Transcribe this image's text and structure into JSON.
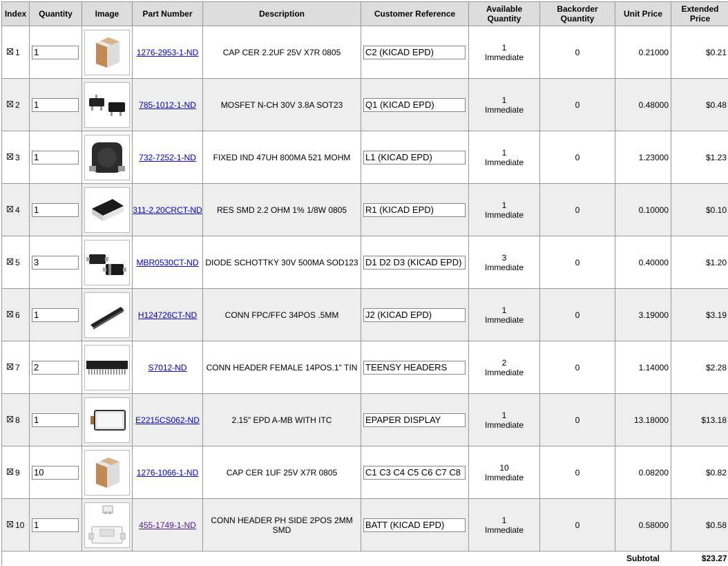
{
  "headers": {
    "index": "Index",
    "quantity": "Quantity",
    "image": "Image",
    "part_number": "Part Number",
    "description": "Description",
    "customer_reference": "Customer Reference",
    "available_quantity": "Available Quantity",
    "backorder_quantity": "Backorder Quantity",
    "unit_price": "Unit Price",
    "extended_price": "Extended Price"
  },
  "rows": [
    {
      "index": "1",
      "quantity": "1",
      "image_icon": "ceramic-capacitor-image",
      "part_number": "1276-2953-1-ND",
      "description": "CAP CER 2.2UF 25V X7R 0805",
      "customer_reference": "C2 (KICAD EPD)",
      "available_qty": "1",
      "available_status": "Immediate",
      "backorder": "0",
      "unit_price": "0.21000",
      "extended_price": "$0.21"
    },
    {
      "index": "2",
      "quantity": "1",
      "image_icon": "mosfet-image",
      "part_number": "785-1012-1-ND",
      "description": "MOSFET N-CH 30V 3.8A SOT23",
      "customer_reference": "Q1 (KICAD EPD)",
      "available_qty": "1",
      "available_status": "Immediate",
      "backorder": "0",
      "unit_price": "0.48000",
      "extended_price": "$0.48"
    },
    {
      "index": "3",
      "quantity": "1",
      "image_icon": "inductor-image",
      "part_number": "732-7252-1-ND",
      "description": "FIXED IND 47UH 800MA 521 MOHM",
      "customer_reference": "L1 (KICAD EPD)",
      "available_qty": "1",
      "available_status": "Immediate",
      "backorder": "0",
      "unit_price": "1.23000",
      "extended_price": "$1.23"
    },
    {
      "index": "4",
      "quantity": "1",
      "image_icon": "resistor-image",
      "part_number": "311-2.20CRCT-ND",
      "description": "RES SMD 2.2 OHM 1% 1/8W 0805",
      "customer_reference": "R1 (KICAD EPD)",
      "available_qty": "1",
      "available_status": "Immediate",
      "backorder": "0",
      "unit_price": "0.10000",
      "extended_price": "$0.10"
    },
    {
      "index": "5",
      "quantity": "3",
      "image_icon": "diode-image",
      "part_number": "MBR0530CT-ND",
      "description": "DIODE SCHOTTKY 30V 500MA SOD123",
      "customer_reference": "D1 D2 D3 (KICAD EPD)",
      "available_qty": "3",
      "available_status": "Immediate",
      "backorder": "0",
      "unit_price": "0.40000",
      "extended_price": "$1.20"
    },
    {
      "index": "6",
      "quantity": "1",
      "image_icon": "fpc-connector-image",
      "part_number": "H124726CT-ND",
      "description": "CONN FPC/FFC 34POS .5MM",
      "customer_reference": "J2 (KICAD EPD)",
      "available_qty": "1",
      "available_status": "Immediate",
      "backorder": "0",
      "unit_price": "3.19000",
      "extended_price": "$3.19"
    },
    {
      "index": "7",
      "quantity": "2",
      "image_icon": "header-connector-image",
      "part_number": "S7012-ND",
      "description": "CONN HEADER FEMALE 14POS.1\" TIN",
      "customer_reference": "TEENSY HEADERS",
      "available_qty": "2",
      "available_status": "Immediate",
      "backorder": "0",
      "unit_price": "1.14000",
      "extended_price": "$2.28"
    },
    {
      "index": "8",
      "quantity": "1",
      "image_icon": "epaper-display-image",
      "part_number": "E2215CS062-ND",
      "description": "2.15\" EPD A-MB WITH ITC",
      "customer_reference": "EPAPER DISPLAY",
      "available_qty": "1",
      "available_status": "Immediate",
      "backorder": "0",
      "unit_price": "13.18000",
      "extended_price": "$13.18"
    },
    {
      "index": "9",
      "quantity": "10",
      "image_icon": "ceramic-capacitor-image",
      "part_number": "1276-1066-1-ND",
      "description": "CAP CER 1UF 25V X7R 0805",
      "customer_reference": "C1 C3 C4 C5 C6 C7 C8",
      "available_qty": "10",
      "available_status": "Immediate",
      "backorder": "0",
      "unit_price": "0.08200",
      "extended_price": "$0.82"
    },
    {
      "index": "10",
      "quantity": "1",
      "image_icon": "ph-header-image",
      "part_number": "455-1749-1-ND",
      "description": "CONN HEADER PH SIDE 2POS 2MM SMD",
      "customer_reference": "BATT (KICAD EPD)",
      "available_qty": "1",
      "available_status": "Immediate",
      "backorder": "0",
      "unit_price": "0.58000",
      "extended_price": "$0.58"
    }
  ],
  "subtotal": {
    "label": "Subtotal",
    "value": "$23.27"
  },
  "colors": {
    "link": "#0000cc",
    "visited_link": "#551a8b",
    "header_bg": "#dddddd",
    "alt_row_bg": "#eeeeee",
    "border": "#999999"
  }
}
